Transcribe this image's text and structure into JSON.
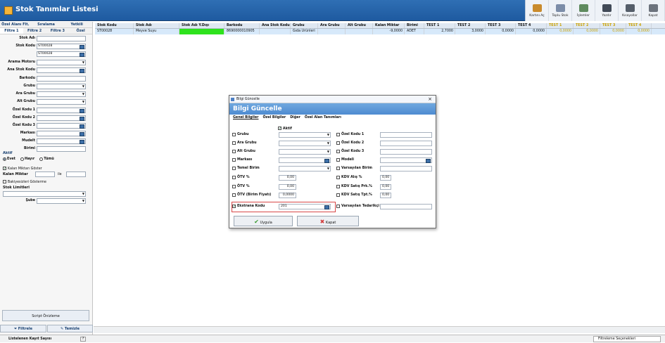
{
  "app": {
    "title": "Stok Tanımlar Listesi"
  },
  "toolbar": {
    "items": [
      {
        "label": "Kartını Aç",
        "icon": "card-icon",
        "color": "#c98b2d"
      },
      {
        "label": "Toplu Stok",
        "icon": "stack-icon",
        "color": "#7c8da8"
      },
      {
        "label": "İşlemler",
        "icon": "process-icon",
        "color": "#5f8b5f"
      },
      {
        "label": "Yazdır",
        "icon": "printer-icon",
        "color": "#414a57"
      },
      {
        "label": "Kısayollar",
        "icon": "shortcut-icon",
        "color": "#555e6a"
      },
      {
        "label": "Kapat",
        "icon": "close-icon",
        "color": "#6c737d"
      }
    ]
  },
  "left": {
    "tabs1": [
      "Özel Alanı Flt.",
      "Sıralama",
      "Yetkili"
    ],
    "tabs2": [
      "Filtre 1",
      "Filtre 2",
      "Filtre 3",
      "Özel"
    ],
    "fields": [
      {
        "label": "Stok Adı",
        "value": "",
        "kind": "text"
      },
      {
        "label": "Stok Kodu",
        "value": "ST00028",
        "kind": "pick"
      },
      {
        "label": "",
        "value": "ST00028",
        "kind": "pick"
      },
      {
        "label": "Arama Motoru",
        "value": "",
        "kind": "dd"
      },
      {
        "label": "Ana Stok Kodu",
        "value": "",
        "kind": "pick"
      },
      {
        "label": "Barkodu",
        "value": "",
        "kind": "text"
      },
      {
        "label": "Grubu",
        "value": "",
        "kind": "dd"
      },
      {
        "label": "Ara Grubu",
        "value": "",
        "kind": "dd"
      },
      {
        "label": "Alt Grubu",
        "value": "",
        "kind": "dd"
      },
      {
        "label": "Özel Kodu 1",
        "value": "",
        "kind": "pick"
      },
      {
        "label": "Özel Kodu 2",
        "value": "",
        "kind": "pick"
      },
      {
        "label": "Özel Kodu 3",
        "value": "",
        "kind": "pick"
      },
      {
        "label": "Markası",
        "value": "",
        "kind": "pick"
      },
      {
        "label": "Mudelt",
        "value": "",
        "kind": "pick"
      },
      {
        "label": "Birimi",
        "value": "",
        "kind": "text"
      }
    ],
    "aktif_label": "Aktif",
    "aktif_options": [
      "Evet",
      "Hayır",
      "Tümü"
    ],
    "kalan_check": "Kalan Miktarı Göster",
    "kalan_label": "Kalan Miktar",
    "ile": "ile",
    "bakiye_check": "Bakiyesizleri Gösterme",
    "stok_limitleri": "Stok Limitleri",
    "sube": "Şube",
    "script_btn": "Script Önizleme",
    "filtrele": "Filtrele",
    "temizle": "Temizle"
  },
  "grid": {
    "headers": [
      "Stok Kodu",
      "Stok Adı",
      "Stok Adı Y.Dışı",
      "Barkodu",
      "Ana Stok Kodu",
      "Grubu",
      "Ara Grubu",
      "Alt Grubu",
      "Kalan Miktar",
      "Birimi",
      "TEST 1",
      "TEST 2",
      "TEST 3",
      "TEST 4",
      "TEST 1",
      "TEST 2",
      "TEST 3",
      "TEST 4"
    ],
    "row": [
      "ST00028",
      "Meyve Suyu",
      "",
      "8690000010905",
      "",
      "Gıda Ürünleri",
      "",
      "",
      "-9,0000",
      "ADET",
      "2,7000",
      "3,0000",
      "0,0000",
      "0,0000",
      "0,0000",
      "0,0000",
      "0,0000",
      "0,0000"
    ]
  },
  "dialog": {
    "title": "Bilgi Güncelle",
    "heading": "Bilgi Güncelle",
    "tabs": [
      "Genel Bilgiler",
      "Özel Bilgiler",
      "Diğer",
      "Özel Alan Tanımları"
    ],
    "aktif": "Aktif",
    "left": [
      {
        "label": "Grubu",
        "value": "",
        "kind": "dd"
      },
      {
        "label": "Ara Grubu",
        "value": "",
        "kind": "dd"
      },
      {
        "label": "Alt Grubu",
        "value": "",
        "kind": "dd"
      },
      {
        "label": "Markası",
        "value": "",
        "kind": "pick"
      },
      {
        "label": "Temel Birim",
        "value": "",
        "kind": "dd"
      },
      {
        "label": "ÖTV %",
        "value": "0,00",
        "kind": "num"
      },
      {
        "label": "ÖTV %",
        "value": "0,00",
        "kind": "num"
      },
      {
        "label": "ÖTV (Birim Fiyatı)",
        "value": "0,0000",
        "kind": "num"
      },
      {
        "label": "Ekstrana Kodu",
        "value": "201",
        "kind": "pick",
        "checked": true
      }
    ],
    "right": [
      {
        "label": "Özel Kodu 1",
        "value": "",
        "kind": "text"
      },
      {
        "label": "Özel Kodu 2",
        "value": "",
        "kind": "text"
      },
      {
        "label": "Özel Kodu 3",
        "value": "",
        "kind": "text"
      },
      {
        "label": "Modeli",
        "value": "",
        "kind": "pick"
      },
      {
        "label": "Varsayılan Birim",
        "value": "",
        "kind": "text"
      },
      {
        "label": "KDV Alış %",
        "value": "0,00",
        "kind": "num"
      },
      {
        "label": "KDV Satış Prk.%",
        "value": "0,00",
        "kind": "num"
      },
      {
        "label": "KDV Satış Tpt.%",
        "value": "0,00",
        "kind": "num"
      },
      {
        "label": "Varsayılan Tedarikçi",
        "value": "",
        "kind": "text"
      }
    ],
    "ok": "Uygula",
    "cancel": "Kapat"
  },
  "status": {
    "left": "Listelenen Kayıt Sayısı",
    "help": "?",
    "right": "Filtreleme Seçenekleri"
  }
}
